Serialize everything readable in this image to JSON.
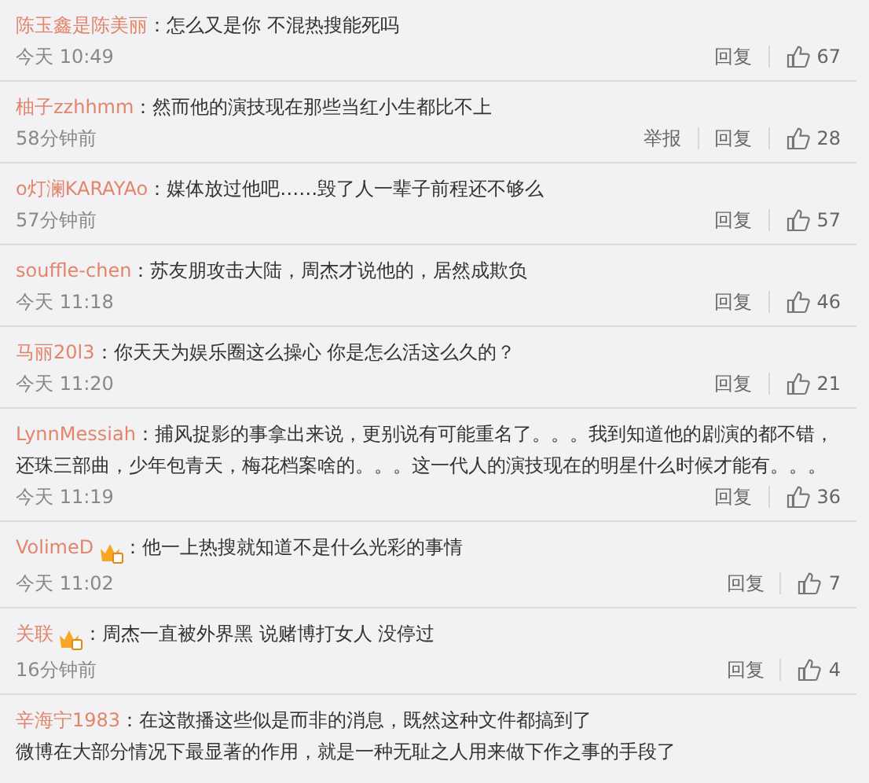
{
  "separator": "：",
  "comments": [
    {
      "user": "陈玉鑫是陈美丽",
      "text": "怎么又是你 不混热搜能死吗",
      "time": "今天 10:49",
      "actions": [
        "回复"
      ],
      "likes": "67"
    },
    {
      "user": "柚子zzhhmm",
      "text": "然而他的演技现在那些当红小生都比不上",
      "time": "58分钟前",
      "actions": [
        "举报",
        "回复"
      ],
      "likes": "28"
    },
    {
      "user": "o灯澜KARAYAo",
      "text": "媒体放过他吧……毁了人一辈子前程还不够么",
      "time": "57分钟前",
      "actions": [
        "回复"
      ],
      "likes": "57"
    },
    {
      "user": "souffle-chen",
      "text": "苏友朋攻击大陆，周杰才说他的，居然成欺负",
      "time": "今天 11:18",
      "actions": [
        "回复"
      ],
      "likes": "46"
    },
    {
      "user": "马丽20l3",
      "text": "你天天为娱乐圈这么操心 你是怎么活这么久的？",
      "time": "今天 11:20",
      "actions": [
        "回复"
      ],
      "likes": "21"
    },
    {
      "user": "LynnMessiah",
      "text": "捕风捉影的事拿出来说，更别说有可能重名了。。。我到知道他的剧演的都不错，还珠三部曲，少年包青天，梅花档案啥的。。。这一代人的演技现在的明星什么时候才能有。。。",
      "time": "今天 11:19",
      "actions": [
        "回复"
      ],
      "likes": "36"
    },
    {
      "user": "VolimeD",
      "vip": true,
      "text": "他一上热搜就知道不是什么光彩的事情",
      "time": "今天 11:02",
      "actions": [
        "回复"
      ],
      "likes": "7"
    },
    {
      "user": "关联",
      "vip": true,
      "text": "周杰一直被外界黑 说赌博打女人 没停过",
      "time": "16分钟前",
      "actions": [
        "回复"
      ],
      "likes": "4"
    },
    {
      "user": "辛海宁1983",
      "text": "在这散播这些似是而非的消息，既然这种文件都搞到了",
      "continuation": "微博在大部分情况下最显著的作用，就是一种无耻之人用来做下作之事的手段了"
    }
  ]
}
